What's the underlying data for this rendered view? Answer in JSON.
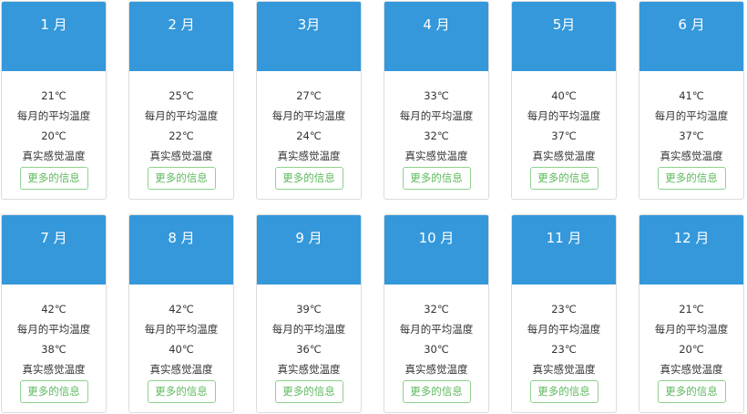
{
  "accent_color": "#3498db",
  "button_color": "#5cb85c",
  "avg_label": "每月的平均温度",
  "feel_label": "真实感觉温度",
  "button_label": "更多的信息",
  "months": [
    {
      "title": "1 月",
      "avg": "21℃",
      "feel": "20℃"
    },
    {
      "title": "2 月",
      "avg": "25℃",
      "feel": "22℃"
    },
    {
      "title": "3月",
      "avg": "27℃",
      "feel": "24℃"
    },
    {
      "title": "4 月",
      "avg": "33℃",
      "feel": "32℃"
    },
    {
      "title": "5月",
      "avg": "40℃",
      "feel": "37℃"
    },
    {
      "title": "6 月",
      "avg": "41℃",
      "feel": "37℃"
    },
    {
      "title": "7 月",
      "avg": "42℃",
      "feel": "38℃"
    },
    {
      "title": "8 月",
      "avg": "42℃",
      "feel": "40℃"
    },
    {
      "title": "9 月",
      "avg": "39℃",
      "feel": "36℃"
    },
    {
      "title": "10 月",
      "avg": "32℃",
      "feel": "30℃"
    },
    {
      "title": "11 月",
      "avg": "23℃",
      "feel": "23℃"
    },
    {
      "title": "12 月",
      "avg": "21℃",
      "feel": "20℃"
    }
  ]
}
